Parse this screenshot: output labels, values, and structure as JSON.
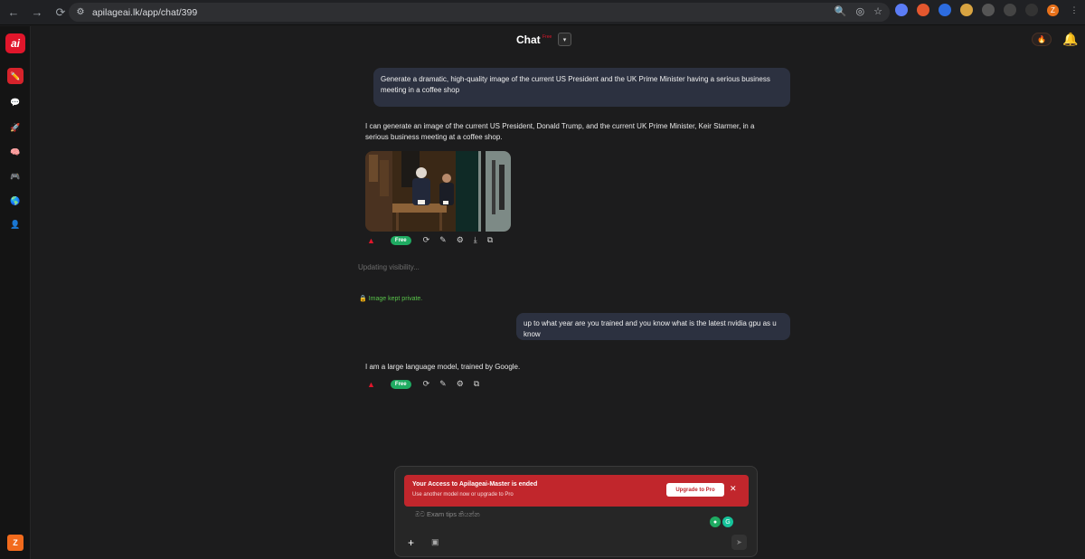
{
  "browser": {
    "url": "apilageai.lk/app/chat/399",
    "back_icon": "←",
    "forward_icon": "→",
    "reload_icon": "⟳",
    "site_icon": "⚙",
    "zoom_icon": "🔍",
    "eye_icon": "◎",
    "star_icon": "☆",
    "profile_initial": "Z"
  },
  "sidebar": {
    "logo": "ai",
    "items": [
      {
        "icon": "✏️",
        "active": true
      },
      {
        "icon": "💬",
        "active": false
      },
      {
        "icon": "🚀",
        "active": false
      },
      {
        "icon": "🧠",
        "active": false
      },
      {
        "icon": "🎮",
        "active": false
      },
      {
        "icon": "🌎",
        "active": false
      },
      {
        "icon": "👤",
        "active": false
      }
    ],
    "avatar_initial": "Z"
  },
  "header": {
    "title": "Chat",
    "badge": "Free",
    "dropdown_icon": "▾",
    "fire": "🔥",
    "bell": "🔔"
  },
  "messages": {
    "user1": "Generate a dramatic, high-quality image of the current US President and the UK Prime Minister having a serious business meeting in a coffee shop",
    "bot1": "I can generate an image of the current US President, Donald Trump, and the current UK Prime Minister, Keir Starmer, in a serious business meeting at a coffee shop.",
    "updating": "Updating visibility...",
    "private_note": "Image kept private.",
    "user2": "up to what year are you trained and you know what is the latest nvidia gpu as u know",
    "bot2": "I am a large language model, trained by Google."
  },
  "actions": {
    "warn": "▲",
    "free": "Free",
    "regenerate": "⟳",
    "edit": "✎",
    "brain": "⚙",
    "download": "⤓",
    "copy": "⧉"
  },
  "composer": {
    "alert_title": "Your Access to Apilageai-Master is ended",
    "alert_sub": "Use another model now or upgrade to Pro",
    "upgrade_label": "Upgrade to Pro",
    "close_icon": "✕",
    "placeholder": "ඔට Exam tips කියන්න",
    "plus_icon": "+",
    "image_icon": "▣",
    "send_icon": "➤"
  }
}
